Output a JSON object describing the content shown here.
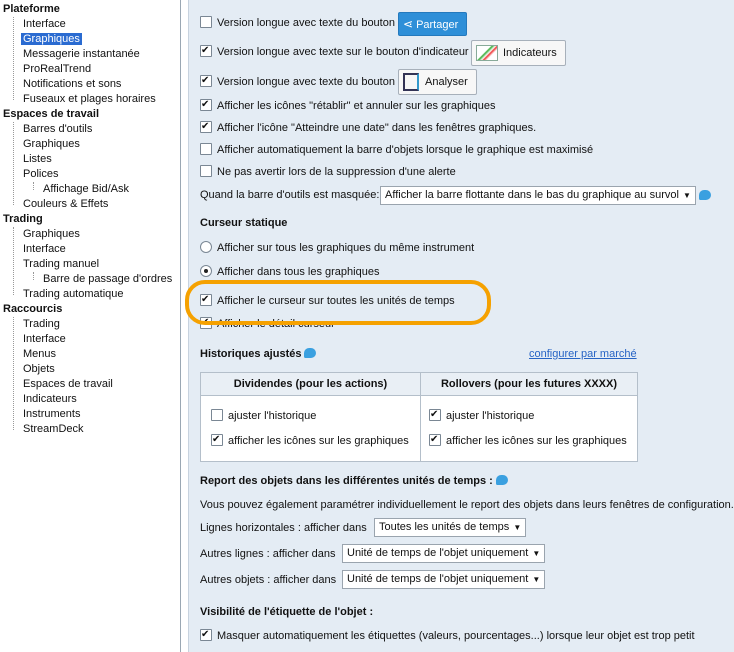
{
  "tree": {
    "groups": [
      {
        "label": "Plateforme",
        "items": [
          "Interface",
          "Graphiques",
          "Messagerie instantanée",
          "ProRealTrend",
          "Notifications et sons",
          "Fuseaux et plages horaires"
        ]
      },
      {
        "label": "Espaces de travail",
        "items": [
          "Barres d'outils",
          "Graphiques",
          "Listes",
          "Polices",
          "Affichage Bid/Ask",
          "Couleurs & Effets"
        ]
      },
      {
        "label": "Trading",
        "items": [
          "Graphiques",
          "Interface",
          "Trading manuel",
          "Barre de passage d'ordres",
          "Trading automatique"
        ]
      },
      {
        "label": "Raccourcis",
        "items": [
          "Trading",
          "Interface",
          "Menus",
          "Objets",
          "Espaces de travail",
          "Indicateurs",
          "Instruments",
          "StreamDeck"
        ]
      }
    ],
    "selected": "Graphiques"
  },
  "settings": {
    "opt1": "Version longue avec texte du bouton",
    "btn_share": "Partager",
    "opt2": "Version longue avec texte sur le bouton d'indicateur",
    "btn_indicators": "Indicateurs",
    "opt3": "Version longue avec texte du bouton",
    "btn_analyse": "Analyser",
    "opt4": "Afficher les icônes \"rétablir\" et annuler sur les graphiques",
    "opt5": "Afficher l'icône \"Atteindre une date\" dans les fenêtres graphiques.",
    "opt6": "Afficher automatiquement la barre d'objets lorsque le graphique est maximisé",
    "opt7": "Ne pas avertir lors de la suppression d'une alerte",
    "toolbar_hidden_label": "Quand la barre d'outils est masquée:",
    "toolbar_hidden_value": "Afficher la barre flottante dans le bas du graphique au survol"
  },
  "cursor": {
    "heading": "Curseur statique",
    "radio1": "Afficher sur tous les graphiques du même instrument",
    "radio2": "Afficher dans tous les graphiques",
    "cb1": "Afficher le curseur sur toutes les unités de temps",
    "cb2": "Afficher le détail curseur"
  },
  "history": {
    "heading": "Historiques ajustés",
    "link": "configurer par marché",
    "col1": "Dividendes (pour les actions)",
    "col2": "Rollovers (pour les futures XXXX)",
    "adjust": "ajuster l'historique",
    "icons": "afficher les icônes sur les graphiques"
  },
  "report": {
    "heading": "Report des objets dans les différentes unités de temps :",
    "desc": "Vous pouvez également paramétrer individuellement le report des objets dans leurs fenêtres de configuration.",
    "h_label": "Lignes horizontales :  afficher dans",
    "h_value": "Toutes les unités de temps",
    "o_label": "Autres lignes : afficher dans",
    "o_value": "Unité de temps de l'objet uniquement",
    "obj_label": "Autres objets : afficher dans",
    "obj_value": "Unité de temps de l'objet uniquement"
  },
  "visibility": {
    "heading": "Visibilité de l'étiquette de l'objet :",
    "cb": "Masquer automatiquement les étiquettes (valeurs, pourcentages...) lorsque leur objet est trop petit"
  }
}
